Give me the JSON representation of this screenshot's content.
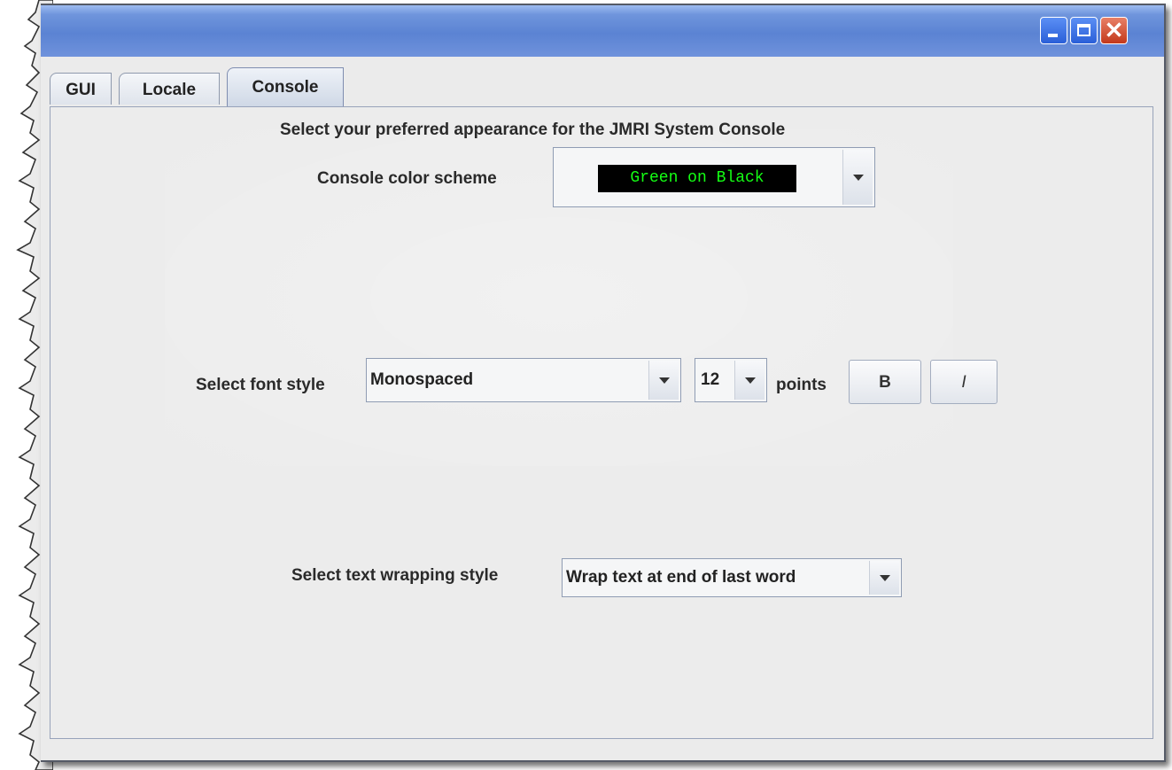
{
  "window": {
    "title": "",
    "controls": {
      "minimize": "minimize-icon",
      "maximize": "maximize-icon",
      "close": "close-icon",
      "close_glyph": "✕"
    },
    "title_gradient": "#5b83d3"
  },
  "tabs": [
    {
      "label": "GUI",
      "selected": false
    },
    {
      "label": "Locale",
      "selected": false
    },
    {
      "label": "Console",
      "selected": true
    }
  ],
  "console_panel": {
    "heading": "Select your preferred appearance for the JMRI System Console",
    "color_scheme": {
      "label": "Console color scheme",
      "selected": "Green on Black",
      "fg_color": "#14ff14",
      "bg_color": "#000000"
    },
    "font_style": {
      "label": "Select font style",
      "font_family": "Monospaced",
      "size": "12",
      "points_label": "points",
      "bold_label": "B",
      "italic_label": "I"
    },
    "text_wrap": {
      "label": "Select text wrapping style",
      "selected": "Wrap text at end of last word"
    }
  }
}
